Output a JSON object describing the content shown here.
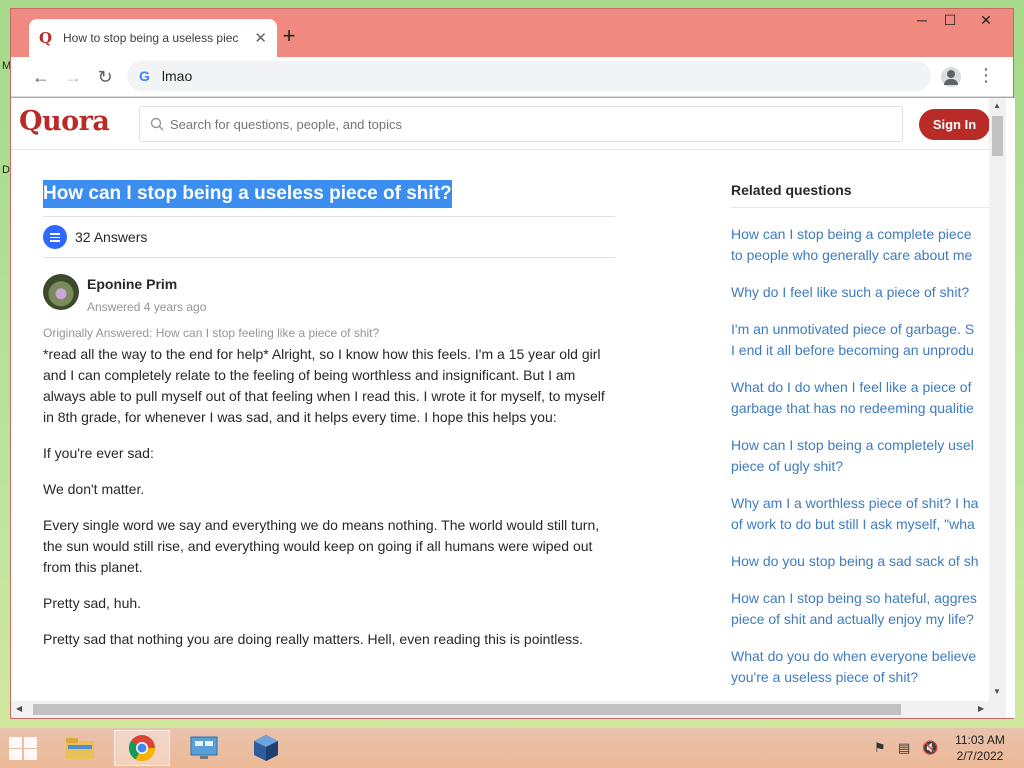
{
  "desktop": {
    "glyph_top": "M",
    "glyph_mid": "D"
  },
  "browser": {
    "tab_title": "How to stop being a useless piec",
    "tab_close": "✕",
    "new_tab": "+",
    "window_controls": {
      "minimize": "─",
      "maximize": "☐",
      "close": "✕"
    },
    "nav": {
      "back": "←",
      "forward": "→",
      "reload": "↻"
    },
    "omnibox_value": "lmao",
    "menu": "⋮"
  },
  "quora": {
    "logo": "Quora",
    "search_placeholder": "Search for questions, people, and topics",
    "signin_label": "Sign In",
    "question_title": "How can I stop being a useless piece of shit?",
    "answers_count": "32 Answers",
    "author_name": "Eponine Prim",
    "author_meta": "Answered 4 years ago",
    "originally_answered": "Originally Answered: How can I stop feeling like a piece of shit?",
    "paragraphs": [
      "*read all the way to the end for help* Alright, so I know how this feels. I'm a 15 year old girl and I can completely relate to the feeling of being worthless and insignificant. But I am always able to pull myself out of that feeling when I read this. I wrote it for myself, to myself in 8th grade, for whenever I was sad, and it helps every time. I hope this helps you:",
      "If you're ever sad:",
      "We don't matter.",
      "Every single word we say and everything we do means nothing. The world would still turn, the sun would still rise, and everything would keep on going if all humans were wiped out from this planet.",
      "Pretty sad, huh.",
      "Pretty sad that nothing you are doing really matters. Hell, even reading this is pointless."
    ],
    "related_title": "Related questions",
    "related": [
      {
        "line1": "How can I stop being a complete piece",
        "line2": "to people who generally care about me"
      },
      {
        "line1": "Why do I feel like such a piece of shit?",
        "line2": ""
      },
      {
        "line1": "I'm an unmotivated piece of garbage. S",
        "line2": "I end it all before becoming an unprodu"
      },
      {
        "line1": "What do I do when I feel like a piece of",
        "line2": "garbage that has no redeeming qualitie"
      },
      {
        "line1": "How can I stop being a completely usel",
        "line2": "piece of ugly shit?"
      },
      {
        "line1": "Why am I a worthless piece of shit? I ha",
        "line2": "of work to do but still I ask myself, \"wha"
      },
      {
        "line1": "How do you stop being a sad sack of sh",
        "line2": ""
      },
      {
        "line1": "How can I stop being so hateful, aggres",
        "line2": "piece of shit and actually enjoy my life?"
      },
      {
        "line1": "What do you do when everyone believe",
        "line2": "you're a useless piece of shit?"
      }
    ]
  },
  "taskbar": {
    "time": "11:03 AM",
    "date": "2/7/2022",
    "apps": [
      "file-explorer",
      "chrome",
      "control-panel",
      "virtualbox"
    ]
  },
  "colors": {
    "quora_red": "#b92b27",
    "title_highlight": "#3b8ef0",
    "link_blue": "#3e7bbf",
    "window_frame": "#f08a80"
  }
}
